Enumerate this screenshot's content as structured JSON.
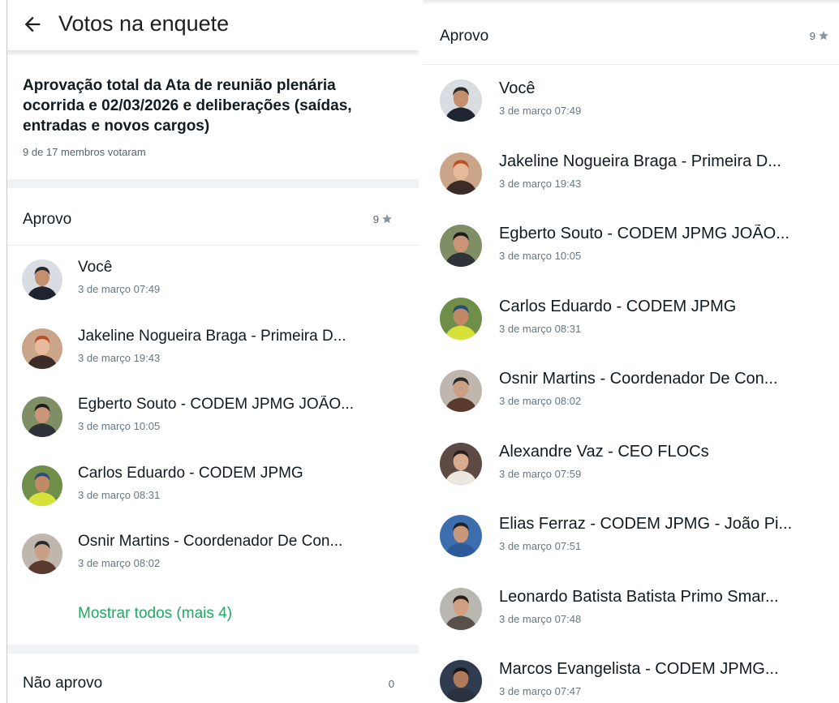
{
  "left": {
    "header_title": "Votos na enquete",
    "question": "Aprovação total da Ata de reunião plenária ocorrida e 02/03/2026 e deliberações (saídas, entradas e novos cargos)",
    "members_voted": "9 de 17 membros votaram",
    "option_approve": {
      "label": "Aprovo",
      "count": "9"
    },
    "voters": [
      {
        "name": "Você",
        "time": "3 de março 07:49",
        "avatar": "man-suit"
      },
      {
        "name": "Jakeline Nogueira Braga - Primeira D...",
        "time": "3 de março 19:43",
        "avatar": "woman-redhair"
      },
      {
        "name": "Egberto Souto - CODEM JPMG JOÃO...",
        "time": "3 de março 10:05",
        "avatar": "man-glasses"
      },
      {
        "name": "Carlos Eduardo - CODEM JPMG",
        "time": "3 de março 08:31",
        "avatar": "man-cap-yellow"
      },
      {
        "name": "Osnir Martins - Coordenador De Con...",
        "time": "3 de março 08:02",
        "avatar": "man-glasses-selfie"
      }
    ],
    "show_all": "Mostrar todos (mais 4)",
    "option_reject": {
      "label": "Não aprovo",
      "count": "0"
    }
  },
  "right": {
    "option_approve": {
      "label": "Aprovo",
      "count": "9"
    },
    "voters": [
      {
        "name": "Você",
        "time": "3 de março 07:49",
        "avatar": "man-suit"
      },
      {
        "name": "Jakeline Nogueira Braga - Primeira D...",
        "time": "3 de março 19:43",
        "avatar": "woman-redhair"
      },
      {
        "name": "Egberto Souto - CODEM JPMG JOÃO...",
        "time": "3 de março 10:05",
        "avatar": "man-glasses"
      },
      {
        "name": "Carlos Eduardo - CODEM JPMG",
        "time": "3 de março 08:31",
        "avatar": "man-cap-yellow"
      },
      {
        "name": "Osnir Martins - Coordenador De Con...",
        "time": "3 de março 08:02",
        "avatar": "man-glasses-selfie"
      },
      {
        "name": "Alexandre Vaz - CEO FLOCs",
        "time": "3 de março 07:59",
        "avatar": "two-people"
      },
      {
        "name": "Elias Ferraz - CODEM JPMG - João Pi...",
        "time": "3 de março 07:51",
        "avatar": "two-people-blue"
      },
      {
        "name": "Leonardo Batista Batista Primo Smar...",
        "time": "3 de março 07:48",
        "avatar": "man-closeup"
      },
      {
        "name": "Marcos Evangelista - CODEM JPMG...",
        "time": "3 de março 07:47",
        "avatar": "man-dark"
      }
    ]
  },
  "colors": {
    "accent": "#1daa61",
    "separator": "#f0f2f5",
    "secondary_text": "#667781"
  }
}
